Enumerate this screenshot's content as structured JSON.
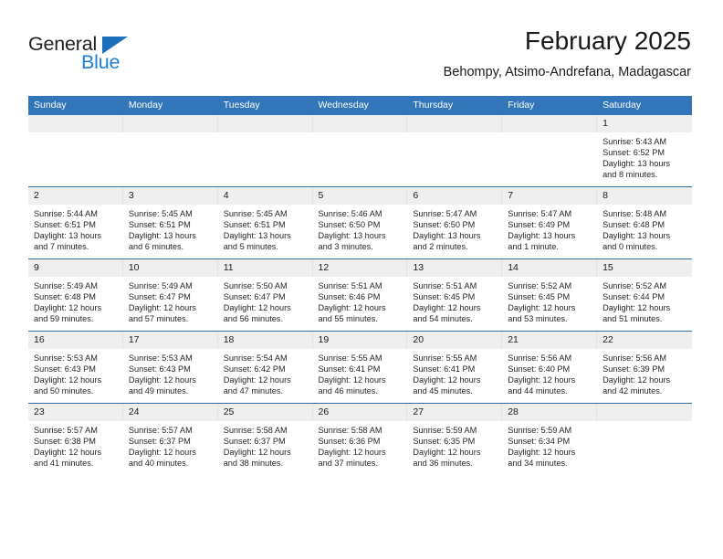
{
  "brand": {
    "name_top": "General",
    "name_bottom": "Blue",
    "triangle_color": "#1c6fba",
    "blue_color": "#1c7fd6"
  },
  "header": {
    "title": "February 2025",
    "subtitle": "Behompy, Atsimo-Andrefana, Madagascar"
  },
  "theme": {
    "header_blue": "#3275b8",
    "row_divider_blue": "#2e6da4",
    "daynum_band": "#efefef"
  },
  "weekday_headers": [
    "Sunday",
    "Monday",
    "Tuesday",
    "Wednesday",
    "Thursday",
    "Friday",
    "Saturday"
  ],
  "weeks": [
    [
      {
        "day": "",
        "empty": true
      },
      {
        "day": "",
        "empty": true
      },
      {
        "day": "",
        "empty": true
      },
      {
        "day": "",
        "empty": true
      },
      {
        "day": "",
        "empty": true
      },
      {
        "day": "",
        "empty": true
      },
      {
        "day": "1",
        "sunrise": "Sunrise: 5:43 AM",
        "sunset": "Sunset: 6:52 PM",
        "daylight_1": "Daylight: 13 hours",
        "daylight_2": "and 8 minutes."
      }
    ],
    [
      {
        "day": "2",
        "sunrise": "Sunrise: 5:44 AM",
        "sunset": "Sunset: 6:51 PM",
        "daylight_1": "Daylight: 13 hours",
        "daylight_2": "and 7 minutes."
      },
      {
        "day": "3",
        "sunrise": "Sunrise: 5:45 AM",
        "sunset": "Sunset: 6:51 PM",
        "daylight_1": "Daylight: 13 hours",
        "daylight_2": "and 6 minutes."
      },
      {
        "day": "4",
        "sunrise": "Sunrise: 5:45 AM",
        "sunset": "Sunset: 6:51 PM",
        "daylight_1": "Daylight: 13 hours",
        "daylight_2": "and 5 minutes."
      },
      {
        "day": "5",
        "sunrise": "Sunrise: 5:46 AM",
        "sunset": "Sunset: 6:50 PM",
        "daylight_1": "Daylight: 13 hours",
        "daylight_2": "and 3 minutes."
      },
      {
        "day": "6",
        "sunrise": "Sunrise: 5:47 AM",
        "sunset": "Sunset: 6:50 PM",
        "daylight_1": "Daylight: 13 hours",
        "daylight_2": "and 2 minutes."
      },
      {
        "day": "7",
        "sunrise": "Sunrise: 5:47 AM",
        "sunset": "Sunset: 6:49 PM",
        "daylight_1": "Daylight: 13 hours",
        "daylight_2": "and 1 minute."
      },
      {
        "day": "8",
        "sunrise": "Sunrise: 5:48 AM",
        "sunset": "Sunset: 6:48 PM",
        "daylight_1": "Daylight: 13 hours",
        "daylight_2": "and 0 minutes."
      }
    ],
    [
      {
        "day": "9",
        "sunrise": "Sunrise: 5:49 AM",
        "sunset": "Sunset: 6:48 PM",
        "daylight_1": "Daylight: 12 hours",
        "daylight_2": "and 59 minutes."
      },
      {
        "day": "10",
        "sunrise": "Sunrise: 5:49 AM",
        "sunset": "Sunset: 6:47 PM",
        "daylight_1": "Daylight: 12 hours",
        "daylight_2": "and 57 minutes."
      },
      {
        "day": "11",
        "sunrise": "Sunrise: 5:50 AM",
        "sunset": "Sunset: 6:47 PM",
        "daylight_1": "Daylight: 12 hours",
        "daylight_2": "and 56 minutes."
      },
      {
        "day": "12",
        "sunrise": "Sunrise: 5:51 AM",
        "sunset": "Sunset: 6:46 PM",
        "daylight_1": "Daylight: 12 hours",
        "daylight_2": "and 55 minutes."
      },
      {
        "day": "13",
        "sunrise": "Sunrise: 5:51 AM",
        "sunset": "Sunset: 6:45 PM",
        "daylight_1": "Daylight: 12 hours",
        "daylight_2": "and 54 minutes."
      },
      {
        "day": "14",
        "sunrise": "Sunrise: 5:52 AM",
        "sunset": "Sunset: 6:45 PM",
        "daylight_1": "Daylight: 12 hours",
        "daylight_2": "and 53 minutes."
      },
      {
        "day": "15",
        "sunrise": "Sunrise: 5:52 AM",
        "sunset": "Sunset: 6:44 PM",
        "daylight_1": "Daylight: 12 hours",
        "daylight_2": "and 51 minutes."
      }
    ],
    [
      {
        "day": "16",
        "sunrise": "Sunrise: 5:53 AM",
        "sunset": "Sunset: 6:43 PM",
        "daylight_1": "Daylight: 12 hours",
        "daylight_2": "and 50 minutes."
      },
      {
        "day": "17",
        "sunrise": "Sunrise: 5:53 AM",
        "sunset": "Sunset: 6:43 PM",
        "daylight_1": "Daylight: 12 hours",
        "daylight_2": "and 49 minutes."
      },
      {
        "day": "18",
        "sunrise": "Sunrise: 5:54 AM",
        "sunset": "Sunset: 6:42 PM",
        "daylight_1": "Daylight: 12 hours",
        "daylight_2": "and 47 minutes."
      },
      {
        "day": "19",
        "sunrise": "Sunrise: 5:55 AM",
        "sunset": "Sunset: 6:41 PM",
        "daylight_1": "Daylight: 12 hours",
        "daylight_2": "and 46 minutes."
      },
      {
        "day": "20",
        "sunrise": "Sunrise: 5:55 AM",
        "sunset": "Sunset: 6:41 PM",
        "daylight_1": "Daylight: 12 hours",
        "daylight_2": "and 45 minutes."
      },
      {
        "day": "21",
        "sunrise": "Sunrise: 5:56 AM",
        "sunset": "Sunset: 6:40 PM",
        "daylight_1": "Daylight: 12 hours",
        "daylight_2": "and 44 minutes."
      },
      {
        "day": "22",
        "sunrise": "Sunrise: 5:56 AM",
        "sunset": "Sunset: 6:39 PM",
        "daylight_1": "Daylight: 12 hours",
        "daylight_2": "and 42 minutes."
      }
    ],
    [
      {
        "day": "23",
        "sunrise": "Sunrise: 5:57 AM",
        "sunset": "Sunset: 6:38 PM",
        "daylight_1": "Daylight: 12 hours",
        "daylight_2": "and 41 minutes."
      },
      {
        "day": "24",
        "sunrise": "Sunrise: 5:57 AM",
        "sunset": "Sunset: 6:37 PM",
        "daylight_1": "Daylight: 12 hours",
        "daylight_2": "and 40 minutes."
      },
      {
        "day": "25",
        "sunrise": "Sunrise: 5:58 AM",
        "sunset": "Sunset: 6:37 PM",
        "daylight_1": "Daylight: 12 hours",
        "daylight_2": "and 38 minutes."
      },
      {
        "day": "26",
        "sunrise": "Sunrise: 5:58 AM",
        "sunset": "Sunset: 6:36 PM",
        "daylight_1": "Daylight: 12 hours",
        "daylight_2": "and 37 minutes."
      },
      {
        "day": "27",
        "sunrise": "Sunrise: 5:59 AM",
        "sunset": "Sunset: 6:35 PM",
        "daylight_1": "Daylight: 12 hours",
        "daylight_2": "and 36 minutes."
      },
      {
        "day": "28",
        "sunrise": "Sunrise: 5:59 AM",
        "sunset": "Sunset: 6:34 PM",
        "daylight_1": "Daylight: 12 hours",
        "daylight_2": "and 34 minutes."
      },
      {
        "day": "",
        "empty": true
      }
    ]
  ]
}
